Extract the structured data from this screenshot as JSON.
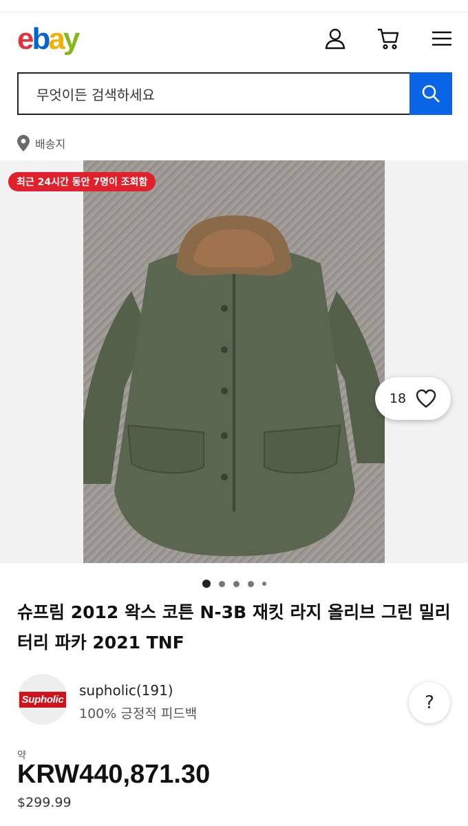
{
  "header": {
    "logo_letters": [
      "e",
      "b",
      "a",
      "y"
    ],
    "icons": [
      "user-icon",
      "cart-icon",
      "menu-icon"
    ]
  },
  "search": {
    "placeholder": "무엇이든 검색하세요",
    "button_icon": "search-icon"
  },
  "ship_to": {
    "icon": "location-pin-icon",
    "label": "배송지"
  },
  "gallery": {
    "views_badge": "최근 24시간 동안 7명이 조회함",
    "watchers_count": "18",
    "watch_icon": "heart-icon",
    "image_count": 5,
    "active_image": 1
  },
  "item": {
    "title": "슈프림 2012 왁스 코튼 N-3B 재킷 라지 올리브 그린 밀리터리 파카 2021 TNF"
  },
  "seller": {
    "avatar_text": "Supholic",
    "name": "supholic(191)",
    "feedback": "100% 긍정적 피드백",
    "help_label": "?"
  },
  "price": {
    "approx_label": "약",
    "converted": "KRW440,871.30",
    "original": "$299.99"
  },
  "colors": {
    "accent_blue": "#0a64e6",
    "badge_red": "#e0202a",
    "ebay_red": "#e53238",
    "ebay_blue": "#0064d2",
    "ebay_yellow": "#f5af02",
    "ebay_green": "#86b817"
  }
}
